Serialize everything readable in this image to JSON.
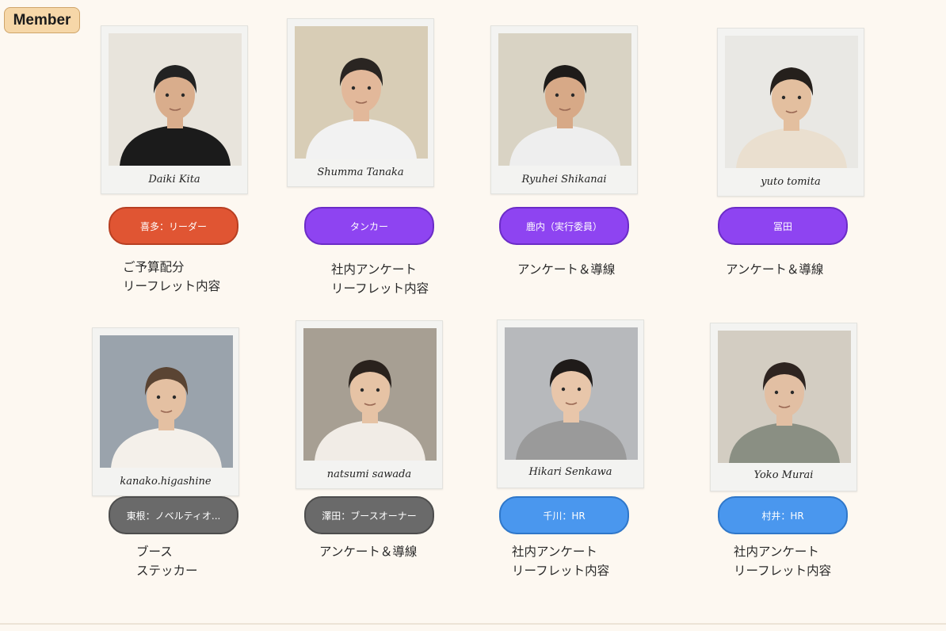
{
  "header": {
    "tag": "Member"
  },
  "members": [
    {
      "name": "Daiki Kita",
      "role": "喜多：リーダー",
      "duties": [
        "ご予算配分",
        "リーフレット内容"
      ],
      "role_color": "red",
      "photo_bg": "#e8e4dc",
      "skin": "#d9ad8c",
      "hair": "#222",
      "shirt": "#1b1b1b"
    },
    {
      "name": "Shumma Tanaka",
      "role": "タンカー",
      "duties": [
        "社内アンケート",
        "リーフレット内容"
      ],
      "role_color": "purple",
      "photo_bg": "#d8cdb6",
      "skin": "#e2b89a",
      "hair": "#2a2522",
      "shirt": "#f2f2f2"
    },
    {
      "name": "Ryuhei Shikanai",
      "role": "鹿内（実行委員）",
      "duties": [
        "アンケート＆導線"
      ],
      "role_color": "purple",
      "photo_bg": "#d9d3c4",
      "skin": "#d7a987",
      "hair": "#1e1b19",
      "shirt": "#eeeeee"
    },
    {
      "name": "yuto tomita",
      "role": "冨田",
      "duties": [
        "アンケート＆導線"
      ],
      "role_color": "purple",
      "photo_bg": "#e9e8e4",
      "skin": "#e3bf9f",
      "hair": "#25201c",
      "shirt": "#eadfcf"
    },
    {
      "name": "kanako.higashine",
      "role": "東根：ノベルティオ...",
      "duties": [
        "ブース",
        "ステッカー"
      ],
      "role_color": "gray",
      "photo_bg": "#9aa3ac",
      "skin": "#e4c0a2",
      "hair": "#5a4433",
      "shirt": "#f4f0ea"
    },
    {
      "name": "natsumi sawada",
      "role": "澤田：ブースオーナー",
      "duties": [
        "アンケート＆導線"
      ],
      "role_color": "gray",
      "photo_bg": "#a79f93",
      "skin": "#e6c3a5",
      "hair": "#2a221d",
      "shirt": "#f1ece6"
    },
    {
      "name": "Hikari Senkawa",
      "role": "千川：HR",
      "duties": [
        "社内アンケート",
        "リーフレット内容"
      ],
      "role_color": "blue",
      "photo_bg": "#b7b9bc",
      "skin": "#e8c6aa",
      "hair": "#1f1b19",
      "shirt": "#9a9a9a"
    },
    {
      "name": "Yoko Murai",
      "role": "村井：HR",
      "duties": [
        "社内アンケート",
        "リーフレット内容"
      ],
      "role_color": "blue",
      "photo_bg": "#d3cdc2",
      "skin": "#e2bfa3",
      "hair": "#2e2420",
      "shirt": "#8a8f83"
    }
  ]
}
